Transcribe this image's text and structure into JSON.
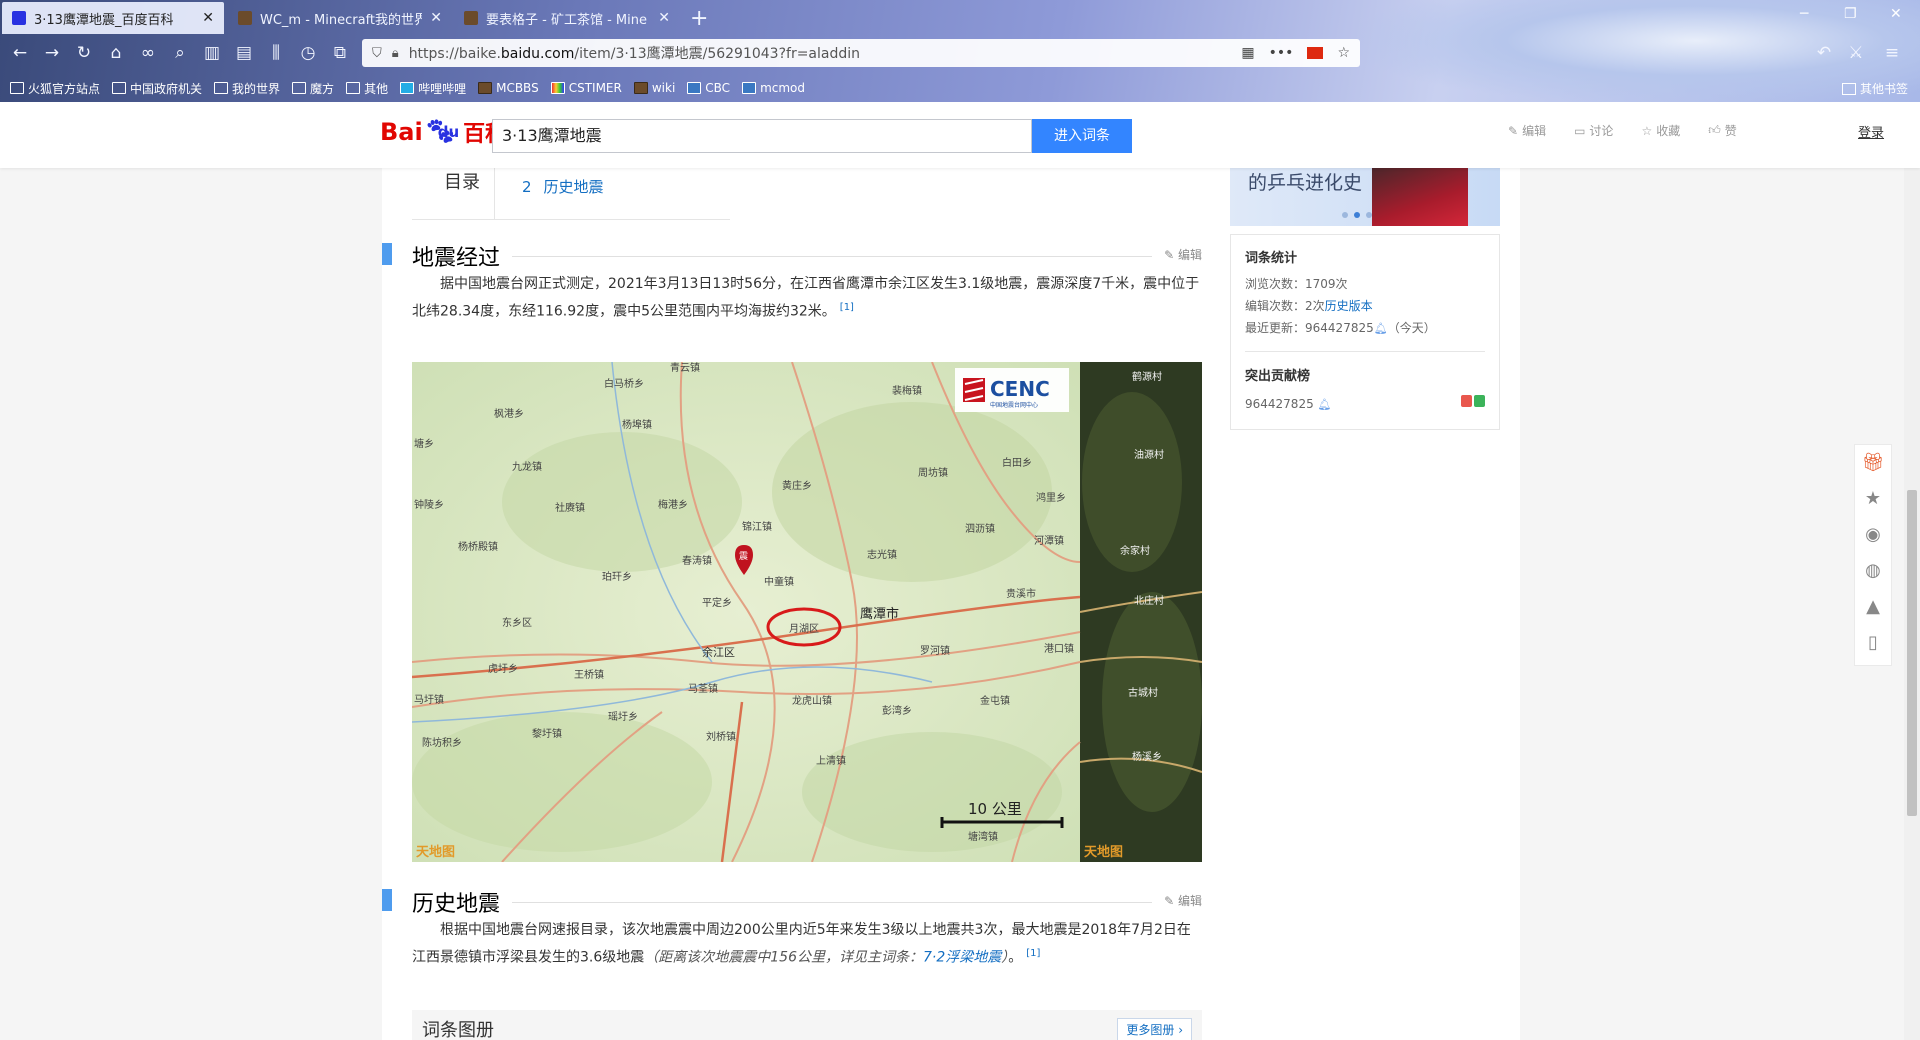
{
  "browser": {
    "tabs": [
      {
        "title": "3·13鹰潭地震_百度百科",
        "active": true,
        "favicon_color": "#2932e1"
      },
      {
        "title": "WC_m - Minecraft我的世界",
        "active": false,
        "favicon_color": "#6b4b2b"
      },
      {
        "title": "要表格子 - 矿工茶馆 - Mine",
        "active": false,
        "favicon_color": "#6b4b2b"
      }
    ],
    "new_tab_label": "+",
    "url_prefix": "https://baike.",
    "url_domain": "baidu.com",
    "url_suffix": "/item/3·13鹰潭地震/56291043?fr=aladdin",
    "bookmarks": [
      "火狐官方站点",
      "中国政府机关",
      "我的世界",
      "魔方",
      "其他",
      "哔哩哔哩",
      "MCBBS",
      "CSTIMER",
      "wiki",
      "CBC",
      "mcmod"
    ],
    "other_bookmarks": "其他书签"
  },
  "header": {
    "logo_bai": "Bai",
    "logo_du": "du",
    "logo_ke": "百科",
    "search_value": "3·13鹰潭地震",
    "search_button": "进入词条",
    "actions": {
      "edit": "编辑",
      "discuss": "讨论",
      "collect": "收藏",
      "like": "赞"
    },
    "login": "登录"
  },
  "toc": {
    "title": "目录",
    "items": [
      {
        "num": "2",
        "label": "历史地震"
      }
    ]
  },
  "sections": [
    {
      "title": "地震经过",
      "edit": "编辑",
      "text": "据中国地震台网正式测定，2021年3月13日13时56分，在江西省鹰潭市余江区发生3.1级地震，震源深度7千米，震中位于北纬28.34度，东经116.92度，震中5公里范围内平均海拔约32米。",
      "ref": "[1]"
    },
    {
      "title": "历史地震",
      "edit": "编辑",
      "text": "根据中国地震台网速报目录，该次地震震中周边200公里内近5年来发生3级以上地震共3次，最大地震是2018年7月2日在江西景德镇市浮梁县发生的3.6级地震",
      "note_prefix": "（距离该次地震震中156公里，详见主词条：",
      "note_link": "7·2浮梁地震",
      "note_suffix": "）",
      "end": "。",
      "ref": "[1]"
    }
  ],
  "map": {
    "logo": "CENC",
    "logo_sub": "中国地震台网中心",
    "scale_label": "10 公里",
    "watermark": "天地图",
    "epicenter_mark": "震",
    "places": [
      "青云镇",
      "白马桥乡",
      "裴梅镇",
      "枫港乡",
      "杨埠镇",
      "塘乡",
      "九龙镇",
      "黄庄乡",
      "周坊镇",
      "白田乡",
      "钟陵乡",
      "社赓镇",
      "梅港乡",
      "鸿里乡",
      "锦江镇",
      "泗沥镇",
      "河潭镇",
      "杨桥殿镇",
      "春涛镇",
      "志光镇",
      "珀玕乡",
      "中童镇",
      "贵溪市",
      "平定乡",
      "东乡区",
      "月湖区",
      "鹰潭市",
      "余江区",
      "罗河镇",
      "港口镇",
      "虎圩乡",
      "王桥镇",
      "马荃镇",
      "马圩镇",
      "瑶圩乡",
      "龙虎山镇",
      "彭湾乡",
      "金屯镇",
      "陈坊积乡",
      "黎圩镇",
      "刘桥镇",
      "上清镇",
      "塘湾镇",
      "鹤源村",
      "油源村",
      "余家村",
      "北庄村",
      "古城村",
      "杨溪乡"
    ],
    "satellite_labels": [
      "鹤源村",
      "油源村",
      "余家村",
      "北庄村",
      "古城村",
      "杨溪乡"
    ]
  },
  "sidebar": {
    "banner_text": "的乒乓进化史",
    "stats_title": "词条统计",
    "views_label": "浏览次数：",
    "views_value": "1709次",
    "edits_label": "编辑次数：",
    "edits_value": "2次",
    "history_link": "历史版本",
    "updated_label": "最近更新：",
    "updated_user": "964427825",
    "updated_when": "（今天）",
    "contrib_title": "突出贡献榜",
    "contrib_user": "964427825"
  },
  "gallery": {
    "title": "词条图册",
    "more": "更多图册 ›"
  },
  "colors": {
    "baidu_red": "#e10602",
    "baidu_blue": "#2932e1",
    "link": "#136ec2",
    "section_bar": "#4f9cee",
    "search_button": "#3385ff"
  }
}
